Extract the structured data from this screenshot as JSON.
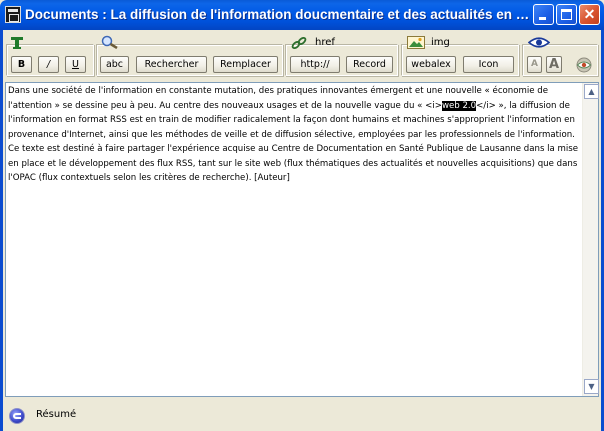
{
  "window": {
    "title": "Documents : La diffusion de l'information doucmentaire et des actualités en for..."
  },
  "toolbar": {
    "format": {
      "bold": "B",
      "italic": "/",
      "underline": "U"
    },
    "search": {
      "abc": "abc",
      "rechercher": "Rechercher",
      "remplacer": "Remplacer"
    },
    "link": {
      "label": "href",
      "http": "http://",
      "record": "Record"
    },
    "image": {
      "label": "img",
      "webalex": "webalex",
      "icon": "Icon"
    },
    "font": {
      "small_a": "A",
      "large_a": "A"
    }
  },
  "editor": {
    "text_before": "Dans une société de l'information en constante mutation, des pratiques innovantes émergent et une nouvelle « économie de l'attention » se dessine peu à peu. Au centre des nouveaux usages et de la nouvelle vague du « <i>",
    "text_selected": "web 2.0",
    "text_after": "</i> », la diffusion de l'information en format RSS est en train de modifier radicalement la façon dont humains et machines s'approprient l'information en provenance d'Internet, ainsi que les méthodes de veille et de diffusion sélective, employées par les professionnels de l'information. Ce texte est destiné à faire partager l'expérience acquise au Centre de Documentation en Santé Publique de Lausanne dans la mise en place et le développement des flux RSS, tant sur le site web (flux thématiques des actualités et nouvelles acquisitions) que dans l'OPAC (flux contextuels selon les critères de recherche). [Auteur]"
  },
  "status": {
    "label": "Résumé"
  },
  "colors": {
    "titlebar": "#0054e3",
    "face": "#ece9d8",
    "selection": "#000000"
  }
}
